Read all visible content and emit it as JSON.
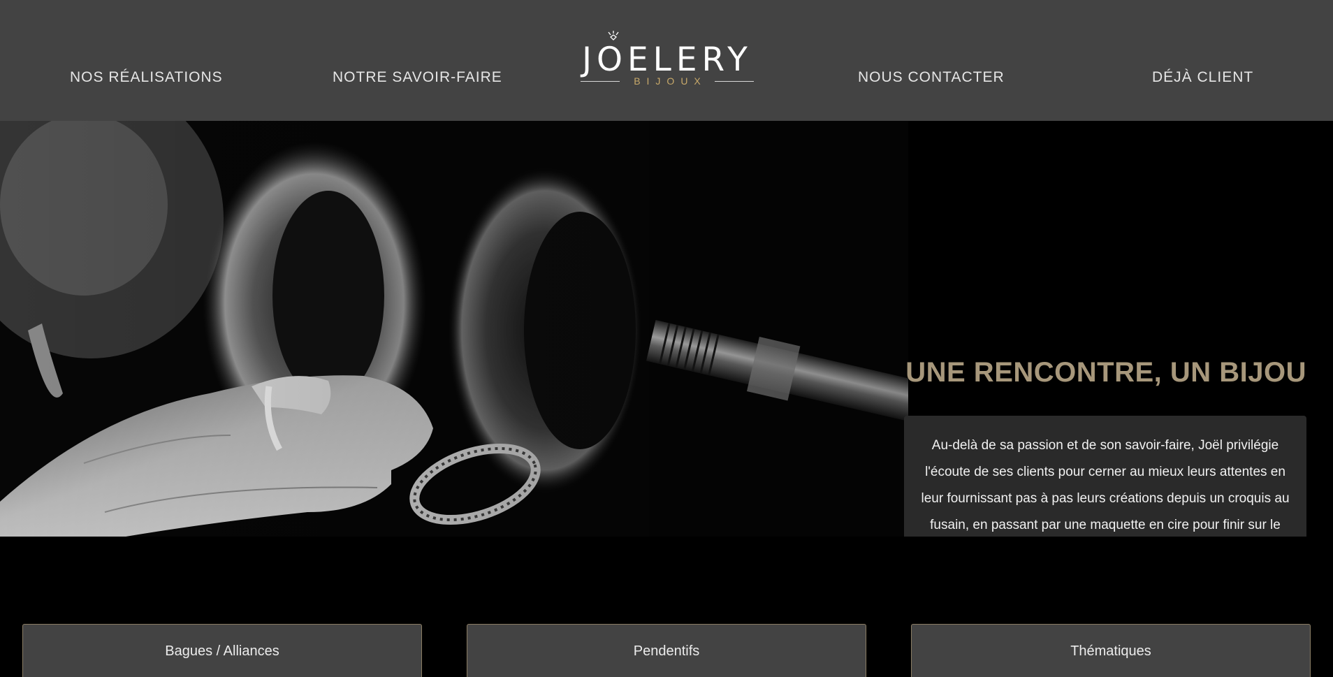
{
  "header": {
    "nav": [
      {
        "label": "NOS RÉALISATIONS"
      },
      {
        "label": "NOTRE SAVOIR-FAIRE"
      },
      {
        "label": "NOUS CONTACTER"
      },
      {
        "label": "DÉJÀ CLIENT"
      }
    ],
    "logo": {
      "word": "JOELERY",
      "sub": "BIJOUX",
      "icon": "ring-icon",
      "sub_color": "#c8a96a"
    }
  },
  "hero": {
    "title": "UNE RENCONTRE, UN BIJOU",
    "text": "Au-delà de sa passion et de son savoir-faire, Joël privilégie l'écoute de ses clients pour cerner au mieux leurs attentes en leur fournissant pas à pas leurs créations depuis un croquis au fusain, en passant par une maquette en cire pour finir sur le bijou fini.",
    "title_color": "#a7977b"
  },
  "categories": [
    {
      "label": "Bagues / Alliances"
    },
    {
      "label": "Pendentifs"
    },
    {
      "label": "Thématiques"
    }
  ],
  "colors": {
    "header_bg": "#434343",
    "page_bg": "#000000",
    "box_bg": "#2a2a2a",
    "accent": "#a7977b"
  }
}
